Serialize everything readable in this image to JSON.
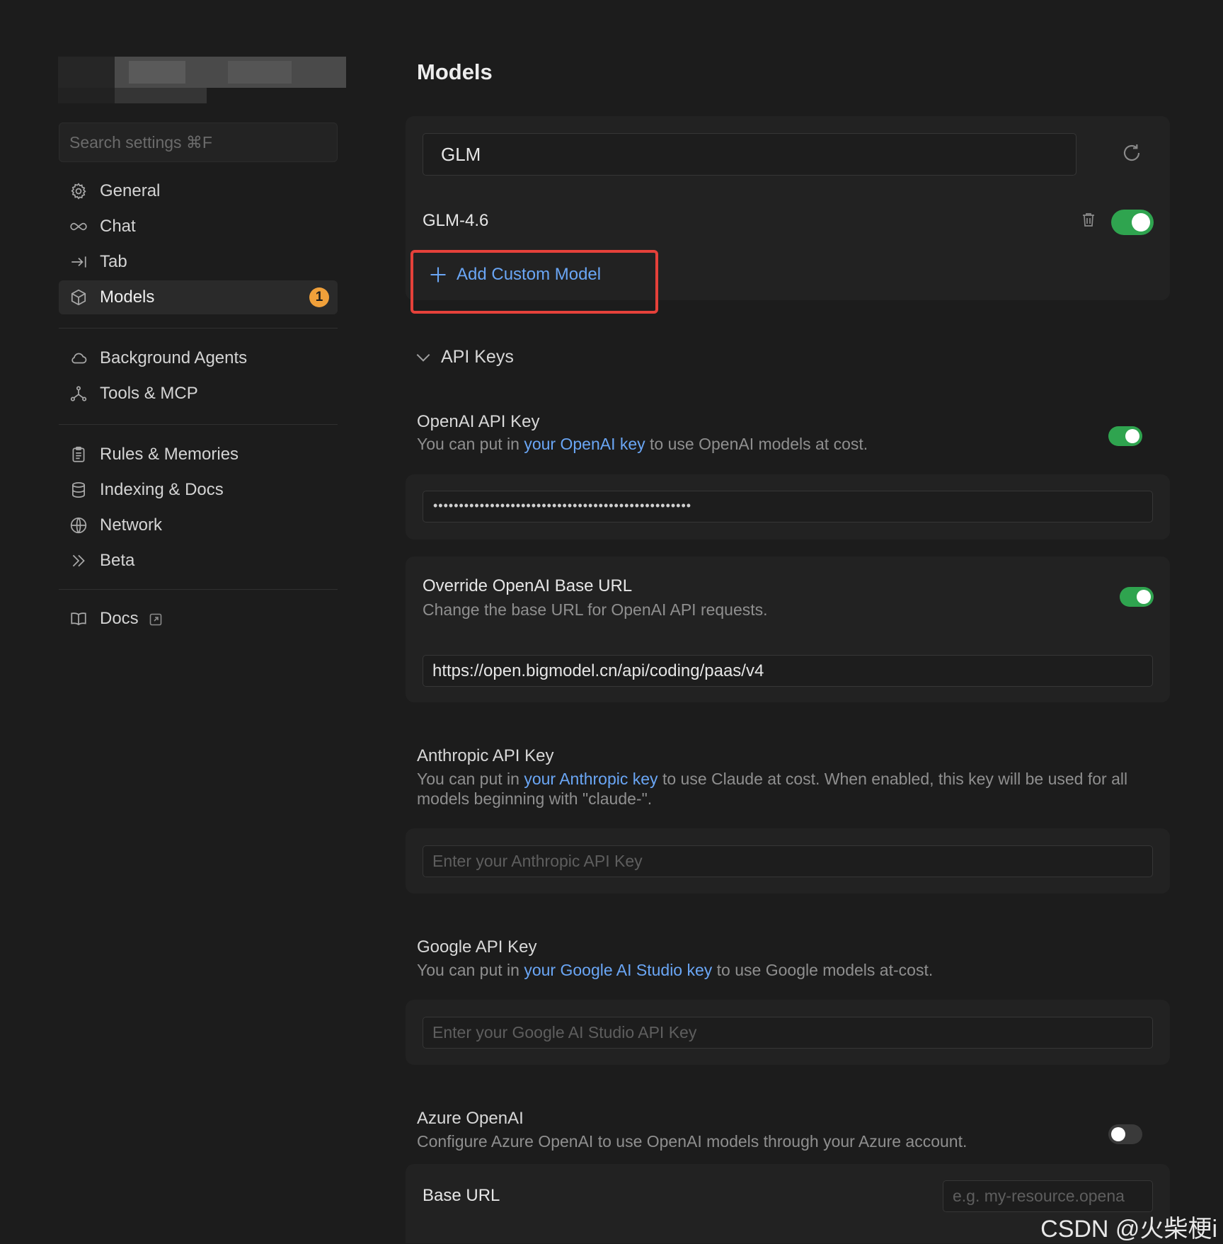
{
  "sidebar": {
    "search_placeholder": "Search settings ⌘F",
    "items": [
      {
        "label": "General",
        "icon": "gear-icon"
      },
      {
        "label": "Chat",
        "icon": "infinity-icon"
      },
      {
        "label": "Tab",
        "icon": "arrow-right-bar-icon"
      },
      {
        "label": "Models",
        "icon": "cube-icon",
        "badge": "1",
        "active": true
      },
      {
        "label": "Background Agents",
        "icon": "cloud-icon"
      },
      {
        "label": "Tools & MCP",
        "icon": "tools-icon"
      },
      {
        "label": "Rules & Memories",
        "icon": "clipboard-icon"
      },
      {
        "label": "Indexing & Docs",
        "icon": "database-icon"
      },
      {
        "label": "Network",
        "icon": "globe-icon"
      },
      {
        "label": "Beta",
        "icon": "double-chevron-icon"
      },
      {
        "label": "Docs",
        "icon": "book-icon"
      }
    ]
  },
  "main": {
    "title": "Models",
    "model_search_value": "GLM",
    "model_name": "GLM-4.6",
    "model_enabled": true,
    "add_custom_model": "Add Custom Model",
    "api_keys_section": "API Keys",
    "openai": {
      "title": "OpenAI API Key",
      "desc_pre": "You can put in ",
      "desc_link": "your OpenAI key",
      "desc_post": " to use OpenAI models at cost.",
      "enabled": true,
      "masked_value": "••••••••••••••••••••••••••••••••••••••••••••••••••"
    },
    "override_base": {
      "title": "Override OpenAI Base URL",
      "desc": "Change the base URL for OpenAI API requests.",
      "enabled": true,
      "value": "https://open.bigmodel.cn/api/coding/paas/v4"
    },
    "anthropic": {
      "title": "Anthropic API Key",
      "desc_pre": "You can put in ",
      "desc_link": "your Anthropic key",
      "desc_post": " to use Claude at cost. When enabled, this key will be used for all models beginning with \"claude-\".",
      "placeholder": "Enter your Anthropic API Key"
    },
    "google": {
      "title": "Google API Key",
      "desc_pre": "You can put in ",
      "desc_link": "your Google AI Studio key",
      "desc_post": " to use Google models at-cost.",
      "placeholder": "Enter your Google AI Studio API Key"
    },
    "azure": {
      "title": "Azure OpenAI",
      "desc": "Configure Azure OpenAI to use OpenAI models through your Azure account.",
      "enabled": false,
      "base_url_label": "Base URL",
      "base_url_placeholder": "e.g. my-resource.opena"
    }
  },
  "watermark": "CSDN @火柴梗i",
  "colors": {
    "accent_toggle": "#2fa44f",
    "link": "#6aa6f5",
    "highlight_box": "#e5413a",
    "badge": "#f0a03a"
  }
}
